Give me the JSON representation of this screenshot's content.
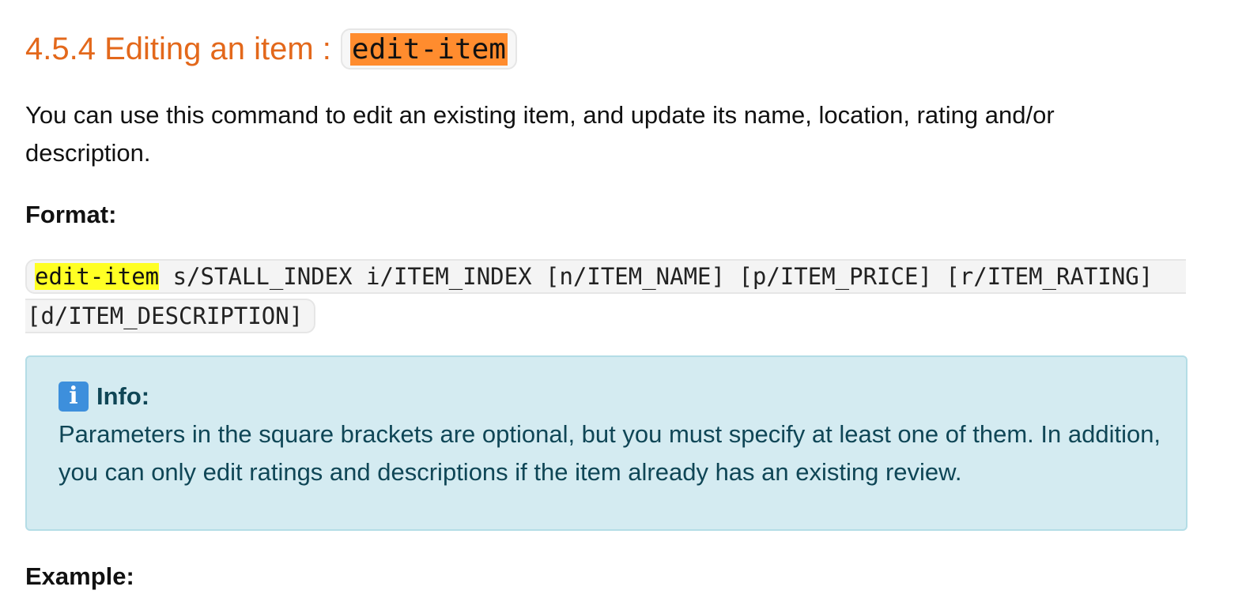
{
  "section": {
    "title_prefix": "4.5.4 Editing an item : ",
    "title_code": "edit-item"
  },
  "intro": "You can use this command to edit an existing item, and update its name, location, rating and/or description.",
  "format": {
    "label": "Format:",
    "command": "edit-item",
    "line1_rest": " s/STALL_INDEX i/ITEM_INDEX [n/ITEM_NAME] [p/ITEM_PRICE] [r/ITEM_RATING]",
    "line2": "[d/ITEM_DESCRIPTION]"
  },
  "info": {
    "icon": "info-icon",
    "heading": "Info:",
    "text": "Parameters in the square brackets are optional, but you must specify at least one of them. In addition, you can only edit ratings and descriptions if the item already has an existing review."
  },
  "example": {
    "label": "Example:"
  },
  "colors": {
    "heading": "#e3681b",
    "title_code_bg": "#ff8c2e",
    "command_highlight": "#ffff24",
    "info_bg": "#d4ebf1",
    "info_text": "#0f4656"
  }
}
